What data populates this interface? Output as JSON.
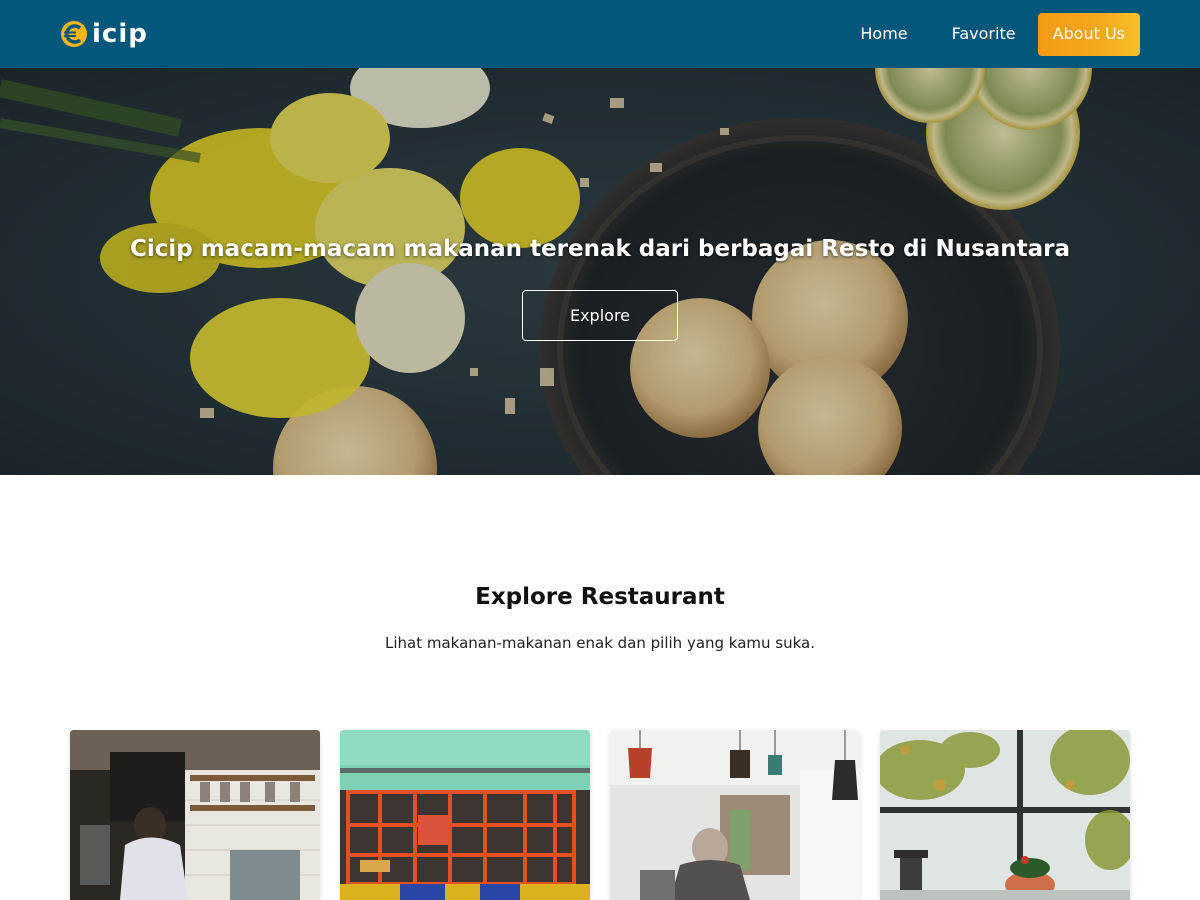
{
  "brand": {
    "name": "icip",
    "logo_icon": "cicip-logo-icon",
    "accent": "#f4a81c"
  },
  "nav": {
    "items": [
      {
        "label": "Home"
      },
      {
        "label": "Favorite"
      },
      {
        "label": "About Us"
      }
    ],
    "active_color": "#f4a81c",
    "bar_color": "#03577a"
  },
  "hero": {
    "title": "Cicip macam-macam makanan terenak dari berbagai Resto di Nusantara",
    "button_label": "Explore"
  },
  "explore": {
    "title": "Explore Restaurant",
    "subtitle": "Lihat makanan-makanan enak dan pilih yang kamu suka."
  },
  "restaurants": [
    {
      "image": "cafe-barista-photo"
    },
    {
      "image": "colorful-shopfront-photo"
    },
    {
      "image": "pendant-lamps-cafe-photo"
    },
    {
      "image": "plants-window-photo"
    }
  ]
}
